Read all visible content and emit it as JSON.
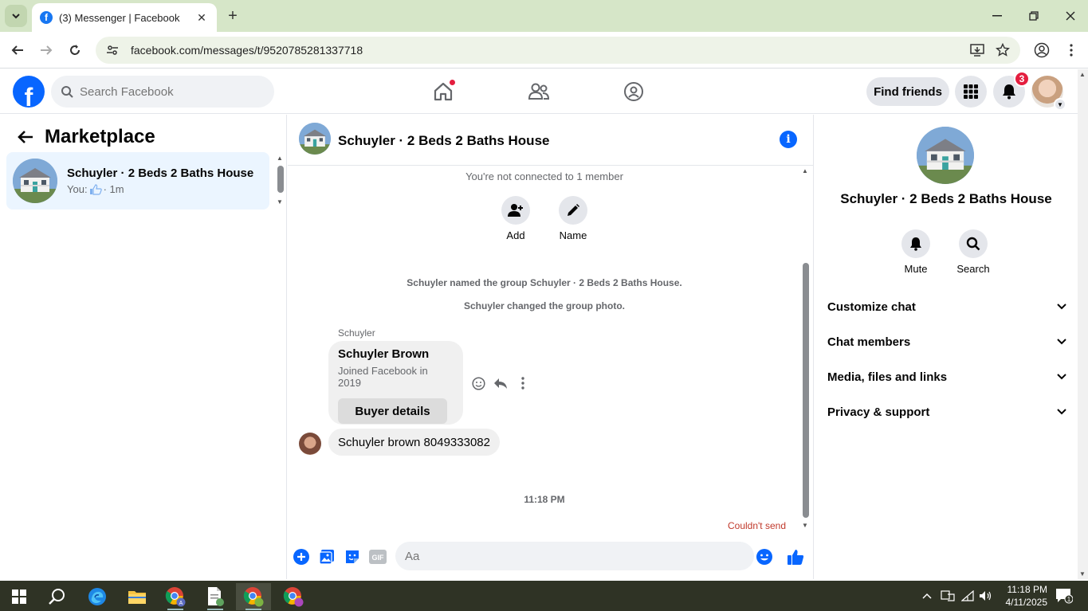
{
  "browser": {
    "tab_title": "(3) Messenger | Facebook",
    "url": "facebook.com/messages/t/9520785281337718"
  },
  "fb_header": {
    "search_placeholder": "Search Facebook",
    "find_friends": "Find friends",
    "notification_count": "3"
  },
  "left": {
    "title": "Marketplace",
    "conversation": {
      "name": "Schuyler · 2 Beds 2 Baths House",
      "preview_prefix": "You:",
      "time": "· 1m"
    }
  },
  "chat": {
    "title": "Schuyler · 2 Beds 2 Baths House",
    "not_connected": "You're not connected to 1 member",
    "actions": {
      "add": "Add",
      "name": "Name"
    },
    "system_messages": [
      "Schuyler named the group Schuyler · 2 Beds 2 Baths House.",
      "Schuyler changed the group photo."
    ],
    "sender": "Schuyler",
    "card": {
      "name": "Schuyler Brown",
      "subtitle": "Joined Facebook in 2019",
      "button": "Buyer details"
    },
    "message": "Schuyler brown 8049333082",
    "timestamp": "11:18 PM",
    "status": "Couldn't send",
    "composer_placeholder": "Aa"
  },
  "right": {
    "title": "Schuyler · 2 Beds 2 Baths House",
    "actions": {
      "mute": "Mute",
      "search": "Search"
    },
    "sections": [
      "Customize chat",
      "Chat members",
      "Media, files and links",
      "Privacy & support"
    ]
  },
  "taskbar": {
    "time": "11:18 PM",
    "date": "4/11/2025",
    "notification_count": "1"
  },
  "colors": {
    "fb_blue": "#0866ff",
    "selected_conversation": "#ebf5ff",
    "error_red": "#c0392b",
    "badge_red": "#e41e3f"
  }
}
